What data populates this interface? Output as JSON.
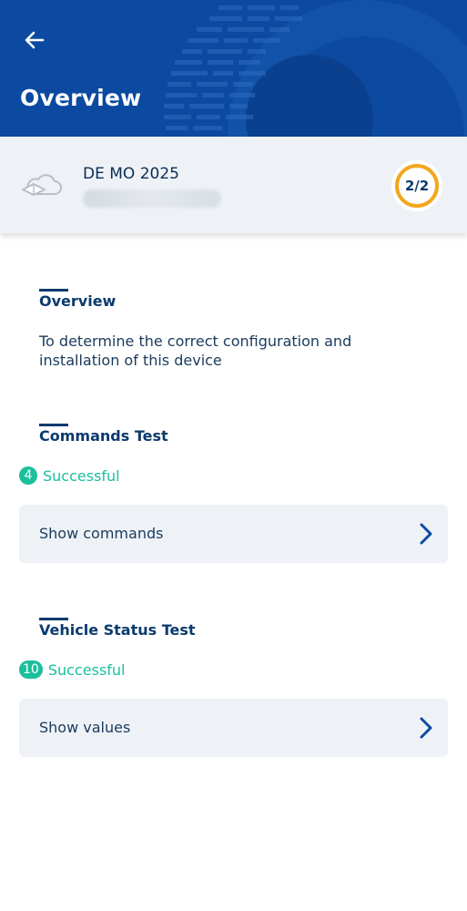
{
  "header": {
    "title": "Overview",
    "back_icon": "arrow-left-icon",
    "background_color": "#0b4aa0"
  },
  "device": {
    "name": "DE MO 2025",
    "icon": "cloud-device-icon",
    "progress_text": "2/2",
    "progress_color": "#f2a71b"
  },
  "overview_section": {
    "title": "Overview",
    "description": "To determine the correct configuration and installation of this device"
  },
  "commands_section": {
    "title": "Commands Test",
    "count": "4",
    "status_label": "Successful",
    "button_label": "Show commands"
  },
  "vehicle_section": {
    "title": "Vehicle Status Test",
    "count": "10",
    "status_label": "Successful",
    "button_label": "Show values"
  },
  "colors": {
    "success": "#1bbf9c",
    "text_primary": "#0b3a6e",
    "card_background": "#eef2f7"
  }
}
